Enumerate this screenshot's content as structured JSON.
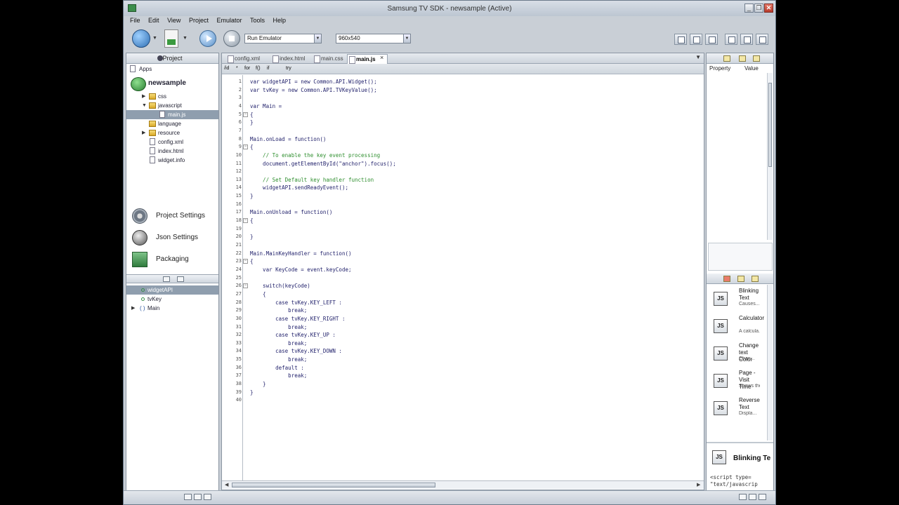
{
  "window": {
    "title": "Samsung TV SDK - newsample (Active)",
    "controls": [
      "_",
      "❐",
      "✕"
    ]
  },
  "menu": [
    "File",
    "Edit",
    "View",
    "Project",
    "Emulator",
    "Tools",
    "Help"
  ],
  "toolbar": {
    "run_mode": "Run Emulator",
    "resolution": "960x540"
  },
  "project_panel": {
    "title": "Project",
    "apps_label": "Apps",
    "project_name": "newsample",
    "tree": [
      {
        "label": "css",
        "kind": "folder",
        "depth": 1,
        "expand": "▶"
      },
      {
        "label": "javascript",
        "kind": "folder",
        "depth": 1,
        "expand": "▼"
      },
      {
        "label": "main.js",
        "kind": "file",
        "depth": 2,
        "selected": true
      },
      {
        "label": "language",
        "kind": "folder",
        "depth": 1
      },
      {
        "label": "resource",
        "kind": "folder",
        "depth": 1,
        "expand": "▶"
      },
      {
        "label": "config.xml",
        "kind": "file",
        "depth": 1
      },
      {
        "label": "index.html",
        "kind": "file",
        "depth": 1
      },
      {
        "label": "widget.info",
        "kind": "file",
        "depth": 1
      }
    ],
    "actions": [
      "Project Settings",
      "Json Settings",
      "Packaging"
    ],
    "outline": [
      {
        "label": "widgetAPI",
        "selected": true
      },
      {
        "label": "tvKey"
      },
      {
        "label": "Main",
        "prefix": "( )",
        "expand": "▶"
      }
    ]
  },
  "editor": {
    "tabs": [
      {
        "label": "config.xml"
      },
      {
        "label": "index.html"
      },
      {
        "label": "main.css"
      },
      {
        "label": "main.js",
        "active": true
      }
    ],
    "snippets": [
      "/id",
      "*",
      "for",
      "f()",
      "if",
      "try"
    ],
    "lines": [
      "var widgetAPI = new Common.API.Widget();",
      "var tvKey = new Common.API.TVKeyValue();",
      "",
      "var Main =",
      "{",
      "}",
      "",
      "Main.onLoad = function()",
      "{",
      "    // To enable the key event processing",
      "    document.getElementById(\"anchor\").focus();",
      "",
      "    // Set Default key handler function",
      "    widgetAPI.sendReadyEvent();",
      "}",
      "",
      "Main.onUnload = function()",
      "{",
      "",
      "}",
      "",
      "Main.MainKeyHandler = function()",
      "{",
      "    var KeyCode = event.keyCode;",
      "",
      "    switch(keyCode)",
      "    {",
      "        case tvKey.KEY_LEFT :",
      "            break;",
      "        case tvKey.KEY_RIGHT :",
      "            break;",
      "        case tvKey.KEY_UP :",
      "            break;",
      "        case tvKey.KEY_DOWN :",
      "            break;",
      "        default :",
      "            break;",
      "    }",
      "}",
      ""
    ],
    "fold_lines": [
      5,
      9,
      18,
      23,
      26
    ]
  },
  "properties": {
    "col_property": "Property",
    "col_value": "Value"
  },
  "snippet_library": [
    {
      "name": "Blinking Text",
      "desc": "Causes..."
    },
    {
      "name": "Calculator",
      "desc": "A calcula..."
    },
    {
      "name": "Change text Color",
      "desc": "Chan..."
    },
    {
      "name": "Page - Visit Time",
      "desc": "Shows the..."
    },
    {
      "name": "Reverse Text",
      "desc": "Displa..."
    }
  ],
  "snippet_preview": {
    "badge": "JS",
    "name": "Blinking Te",
    "code": "<script type=\n\"text/javascrip"
  }
}
